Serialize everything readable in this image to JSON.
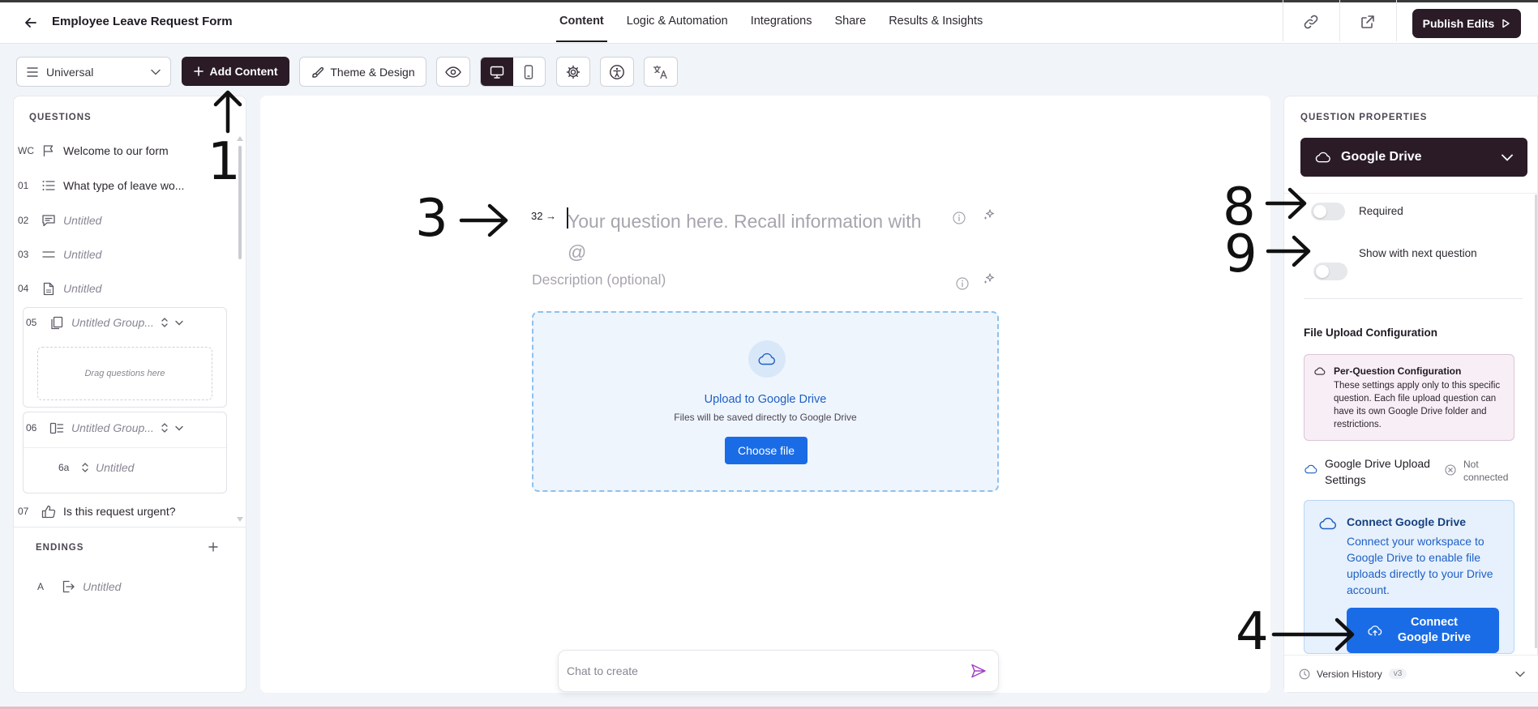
{
  "header": {
    "form_title": "Employee Leave Request Form",
    "tabs": [
      {
        "label": "Content",
        "active": true
      },
      {
        "label": "Logic & Automation",
        "active": false
      },
      {
        "label": "Integrations",
        "active": false
      },
      {
        "label": "Share",
        "active": false
      },
      {
        "label": "Results & Insights",
        "active": false
      }
    ],
    "publish_label": "Publish Edits"
  },
  "toolbar": {
    "view_select": "Universal",
    "add_content_label": "Add Content",
    "theme_label": "Theme & Design"
  },
  "questions_panel": {
    "heading": "QUESTIONS",
    "items": [
      {
        "num": "WC",
        "text": "Welcome to our form",
        "icon": "flag-icon",
        "untitled": false
      },
      {
        "num": "01",
        "text": "What type of leave wo...",
        "icon": "list-icon",
        "untitled": false
      },
      {
        "num": "02",
        "text": "Untitled",
        "icon": "comment-icon",
        "untitled": true
      },
      {
        "num": "03",
        "text": "Untitled",
        "icon": "equals-icon",
        "untitled": true
      },
      {
        "num": "04",
        "text": "Untitled",
        "icon": "document-icon",
        "untitled": true
      },
      {
        "num": "05",
        "text": "Untitled Group...",
        "icon": "copy-icon",
        "untitled": true
      },
      {
        "num": "06",
        "text": "Untitled Group...",
        "icon": "layout-icon",
        "untitled": true
      },
      {
        "num": "6a",
        "text": "Untitled",
        "untitled": true
      },
      {
        "num": "07",
        "text": "Is this request urgent?",
        "icon": "thumbs-up-icon",
        "untitled": false
      }
    ],
    "drag_hint": "Drag questions here",
    "endings_heading": "ENDINGS",
    "endings": [
      {
        "num": "A",
        "text": "Untitled",
        "icon": "exit-icon"
      }
    ]
  },
  "editor": {
    "question_prefix": "32 →",
    "question_placeholder": "Your question here. Recall information with @",
    "description_placeholder": "Description (optional)",
    "upload_title": "Upload to Google Drive",
    "upload_subtitle": "Files will be saved directly to Google Drive",
    "choose_file_label": "Choose file",
    "chat_placeholder": "Chat to create"
  },
  "properties_panel": {
    "heading": "QUESTION PROPERTIES",
    "type_select": "Google Drive",
    "required_label": "Required",
    "show_next_label": "Show with next question",
    "required_on": false,
    "show_next_on": false,
    "file_upload_heading": "File Upload Configuration",
    "per_question_title": "Per-Question Configuration",
    "per_question_desc": "These settings apply only to this specific question. Each file upload question can have its own Google Drive folder and restrictions.",
    "gd_settings_label": "Google Drive Upload Settings",
    "not_connected_label": "Not connected",
    "connect_title": "Connect Google Drive",
    "connect_desc": "Connect your workspace to Google Drive to enable file uploads directly to your Drive account.",
    "connect_button": "Connect Google Drive",
    "version_history_label": "Version History",
    "version_badge": "v3"
  },
  "annotations": {
    "n1": "1",
    "n3": "3",
    "n4": "4",
    "n8": "8",
    "n9": "9"
  },
  "colors": {
    "brand_dark": "#2a1b27",
    "primary_blue": "#1a6ce6",
    "upload_border": "#8ec1ee"
  }
}
